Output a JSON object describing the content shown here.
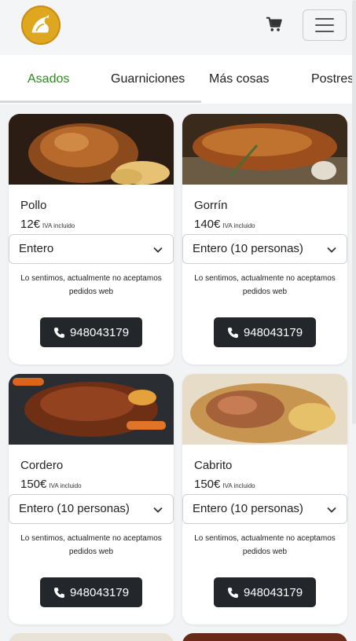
{
  "header": {
    "logo_name": "rooster-logo",
    "cart_icon": "cart-icon",
    "menu_icon": "hamburger-menu-icon"
  },
  "tabs": [
    {
      "label": "Asados",
      "active": true
    },
    {
      "label": "Guarniciones",
      "active": false
    },
    {
      "label": "Más cosas",
      "active": false
    },
    {
      "label": "Postres",
      "active": false
    }
  ],
  "colors": {
    "accent": "#2e8b1e",
    "logo": "#dfa620",
    "button": "#23272b"
  },
  "products": [
    {
      "name": "Pollo",
      "price": "12€",
      "tax_note": "IVA incluido",
      "option": "Entero",
      "note": "Lo sentimos, actualmente no aceptamos pedidos web",
      "phone": "948043179"
    },
    {
      "name": "Gorrín",
      "price": "140€",
      "tax_note": "IVA incluido",
      "option": "Entero (10 personas)",
      "note": "Lo sentimos, actualmente no aceptamos pedidos web",
      "phone": "948043179"
    },
    {
      "name": "Cordero",
      "price": "150€",
      "tax_note": "IVA incluido",
      "option": "Entero (10 personas)",
      "note": "Lo sentimos, actualmente no aceptamos pedidos web",
      "phone": "948043179"
    },
    {
      "name": "Cabrito",
      "price": "150€",
      "tax_note": "IVA incluido",
      "option": "Entero (10 personas)",
      "note": "Lo sentimos, actualmente no aceptamos pedidos web",
      "phone": "948043179"
    }
  ]
}
